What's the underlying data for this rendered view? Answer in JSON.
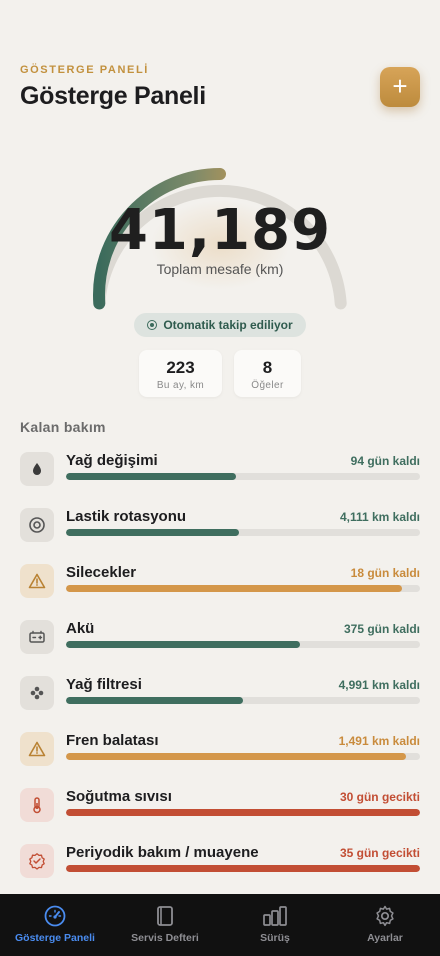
{
  "header": {
    "eyebrow": "GÖSTERGE PANELİ",
    "title": "Gösterge Paneli",
    "add_label": "+"
  },
  "gauge": {
    "value": "41,189",
    "label": "Toplam mesafe (km)",
    "progress": 0.5,
    "colors": {
      "start": "#3b6b5c",
      "end": "#d49a4c",
      "track": "#dcd9d3"
    }
  },
  "tracking": {
    "label": "Otomatik takip ediliyor"
  },
  "stats": [
    {
      "value": "223",
      "label": "Bu ay, km"
    },
    {
      "value": "8",
      "label": "Öğeler"
    }
  ],
  "maintenance": {
    "title": "Kalan bakım",
    "items": [
      {
        "name": "Yağ değişimi",
        "status": "94 gün kaldı",
        "progress": 0.48,
        "state": "ok",
        "icon": "drop-icon"
      },
      {
        "name": "Lastik rotasyonu",
        "status": "4,111 km kaldı",
        "progress": 0.49,
        "state": "ok",
        "icon": "tire-icon"
      },
      {
        "name": "Silecekler",
        "status": "18 gün kaldı",
        "progress": 0.95,
        "state": "warn",
        "icon": "warning-icon"
      },
      {
        "name": "Akü",
        "status": "375 gün kaldı",
        "progress": 0.66,
        "state": "ok",
        "icon": "battery-icon"
      },
      {
        "name": "Yağ filtresi",
        "status": "4,991 km kaldı",
        "progress": 0.5,
        "state": "ok",
        "icon": "filter-icon"
      },
      {
        "name": "Fren balatası",
        "status": "1,491 km kaldı",
        "progress": 0.96,
        "state": "warn",
        "icon": "warning-icon"
      },
      {
        "name": "Soğutma sıvısı",
        "status": "30 gün gecikti",
        "progress": 1.0,
        "state": "over",
        "icon": "thermometer-icon"
      },
      {
        "name": "Periyodik bakım / muayene",
        "status": "35 gün gecikti",
        "progress": 1.0,
        "state": "over",
        "icon": "badge-check-icon"
      }
    ]
  },
  "colors": {
    "ok": "#3f6e5f",
    "warn": "#d4974a",
    "over": "#c24e34",
    "ok_text": "#3f6e5f",
    "warn_text": "#c98b3c",
    "over_text": "#c24e34"
  },
  "tabbar": {
    "tabs": [
      {
        "label": "Gösterge Paneli",
        "icon": "speedometer-icon",
        "active": true
      },
      {
        "label": "Servis Defteri",
        "icon": "book-icon",
        "active": false
      },
      {
        "label": "Sürüş",
        "icon": "bar-chart-icon",
        "active": false
      },
      {
        "label": "Ayarlar",
        "icon": "gear-icon",
        "active": false
      }
    ]
  }
}
